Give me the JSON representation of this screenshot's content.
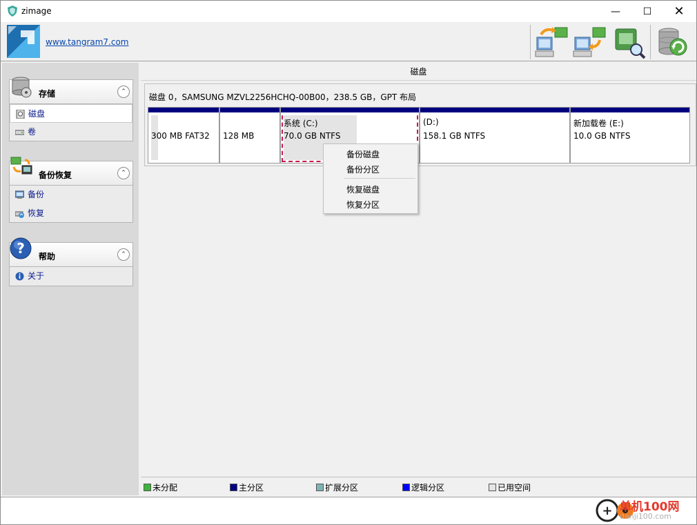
{
  "window": {
    "title": "zimage",
    "minimize": "—",
    "maximize": "☐",
    "close": "✕"
  },
  "header": {
    "link": "www.tangram7.com",
    "tools": [
      "backup-disk-icon",
      "restore-disk-icon",
      "browse-image-icon",
      "refresh-database-icon"
    ]
  },
  "sidebar": {
    "groups": [
      {
        "title": "存储",
        "icon": "storage-icon",
        "items": [
          {
            "label": "磁盘",
            "icon": "disk-icon",
            "selected": true
          },
          {
            "label": "卷",
            "icon": "volume-icon",
            "selected": false
          }
        ]
      },
      {
        "title": "备份恢复",
        "icon": "backup-restore-icon",
        "items": [
          {
            "label": "备份",
            "icon": "backup-icon"
          },
          {
            "label": "恢复",
            "icon": "restore-icon"
          }
        ]
      },
      {
        "title": "帮助",
        "icon": "help-icon",
        "items": [
          {
            "label": "关于",
            "icon": "info-icon"
          }
        ]
      }
    ]
  },
  "main": {
    "title": "磁盘",
    "disk_label": "磁盘 0，SAMSUNG MZVL2256HCHQ-00B00，238.5 GB，GPT 布局",
    "partitions": [
      {
        "name": "",
        "size": "300 MB FAT32",
        "used": 0.04
      },
      {
        "name": "",
        "size": "128 MB",
        "used": 0.0
      },
      {
        "name": "系统   (C:)",
        "size": "70.0 GB NTFS",
        "used": 0.53
      },
      {
        "name": "   (D:)",
        "size": "158.1 GB NTFS",
        "used": 0.0
      },
      {
        "name": "新加载卷   (E:)",
        "size": "10.0 GB NTFS",
        "used": 0.0
      }
    ]
  },
  "context_menu": {
    "items": [
      "备份磁盘",
      "备份分区",
      "恢复磁盘",
      "恢复分区"
    ]
  },
  "legend": [
    {
      "label": "未分配",
      "color": "#3cb43c"
    },
    {
      "label": "主分区",
      "color": "#00007f"
    },
    {
      "label": "扩展分区",
      "color": "#7fb3b3"
    },
    {
      "label": "逻辑分区",
      "color": "#0000ff"
    },
    {
      "label": "已用空间",
      "color": "#e4e4e4"
    }
  ],
  "watermark": {
    "line1": "单机100网",
    "line2": "danji100.com"
  }
}
